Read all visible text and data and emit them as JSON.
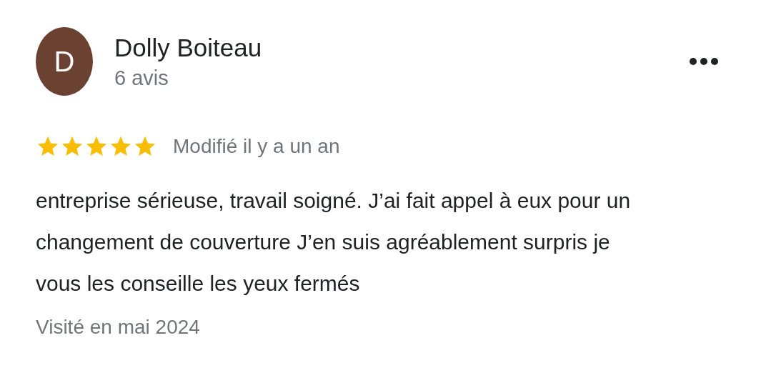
{
  "review": {
    "author": {
      "initial": "D",
      "name": "Dolly Boiteau",
      "reviews_count": "6 avis"
    },
    "stars": 5,
    "date": "Modifié il y a un an",
    "text": "entreprise sérieuse, travail soigné. J’ai fait appel à eux pour un changement de couverture J’en suis agréablement surpris je vous les conseille les yeux fermés",
    "visit": "Visité en mai 2024"
  }
}
